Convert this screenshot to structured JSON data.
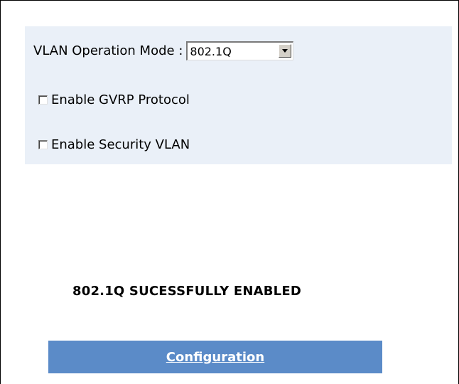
{
  "settings": {
    "mode_label": "VLAN Operation Mode :",
    "mode_selected": "802.1Q",
    "gvrp_label": "Enable GVRP Protocol",
    "gvrp_checked": false,
    "security_label": "Enable Security VLAN",
    "security_checked": false
  },
  "status": {
    "message": "802.1Q SUCESSFULLY ENABLED"
  },
  "actions": {
    "configuration_label": "Configuration"
  },
  "colors": {
    "panel_background": "#eaf0f8",
    "config_bar_background": "#5b8bc8",
    "config_text": "#ffffff"
  },
  "icons": {
    "select_arrow": "chevron-down-icon",
    "checkbox": "checkbox-unchecked-icon"
  }
}
